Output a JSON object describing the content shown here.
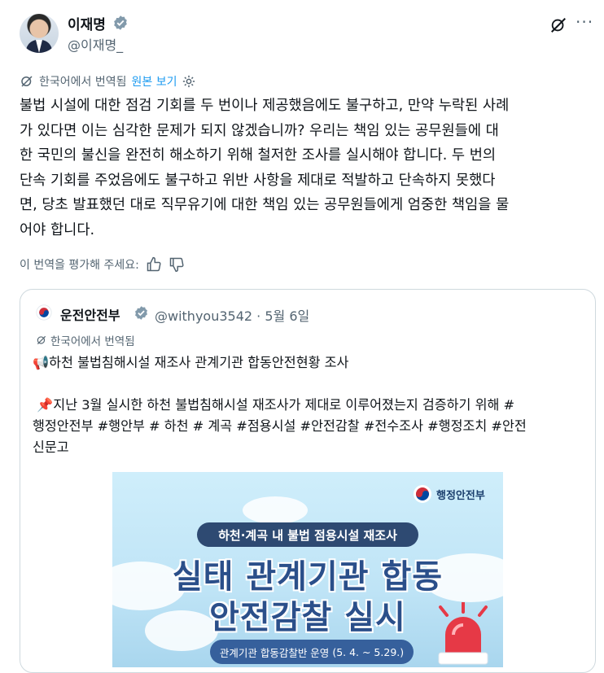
{
  "author": {
    "display_name": "이재명",
    "handle": "@이재명_"
  },
  "translation_bar": {
    "label": "한국어에서 번역됨",
    "link": "원본 보기"
  },
  "tweet_text": "불법 시설에 대한 점검 기회를 두 번이나 제공했음에도 불구하고, 만약 누락된 사례\n가 있다면 이는 심각한 문제가 되지 않겠습니까? 우리는 책임 있는 공무원들에 대\n한 국민의 불신을 완전히 해소하기 위해 철저한 조사를 실시해야 합니다. 두 번의\n단속 기회를 주었음에도 불구하고 위반 사항을 제대로 적발하고 단속하지 못했다\n면, 당초 발표했던 대로 직무유기에 대한 책임 있는 공무원들에게 엄중한 책임을 물\n어야 합니다.",
  "rating": {
    "prompt": "이 번역을 평가해 주세요:"
  },
  "quoted": {
    "name": "운전안전부",
    "handle": "@withyou3542",
    "separator": "·",
    "date": "5월 6일",
    "translation_label": "한국어에서 번역됨",
    "text": "📢하천 불법침해시설 재조사 관계기관 합동안전현황 조사\n\n 📌지난 3월 실시한 하천 불법침해시설 재조사가 제대로 이루어졌는지 검증하기 위해 #\n행정안전부 #행안부 # 하천 # 계곡 #점용시설 #안전감찰 #전수조사 #행정조치 #안전\n신문고",
    "image": {
      "badge": "행정안전부",
      "pill": "하천·계곡 내 불법 점용시설 재조사",
      "headline_1": "실태 관계기관 합동",
      "headline_2": "안전감찰 실시",
      "footer_main": "관계기관 합동감찰반 운영",
      "footer_dates": "(5. 4. ~ 5.29.)"
    }
  },
  "colors": {
    "accent": "#1d9bf0",
    "muted": "#536471",
    "border": "#cfd9de"
  }
}
